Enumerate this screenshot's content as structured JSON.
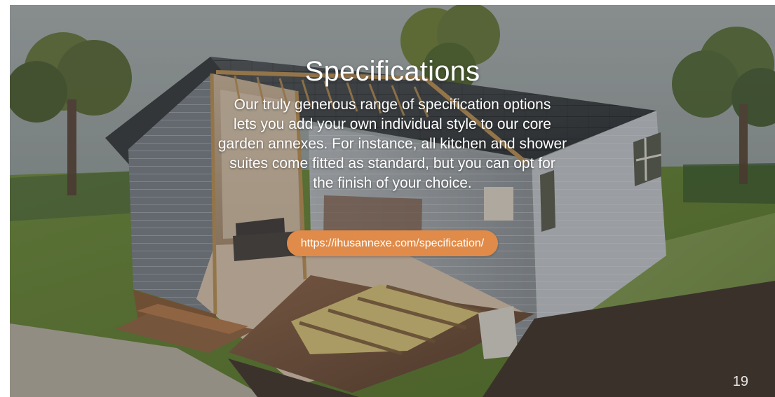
{
  "slide": {
    "title": "Specifications",
    "body_lines": [
      "Our truly generous range of specification options",
      "lets you add your own individual style to our core",
      "garden annexes. For instance, all kitchen and shower",
      "suites come fitted as standard, but you can opt for",
      "the finish of your choice."
    ],
    "link_text": "https://ihusannexe.com/specification/",
    "page_number": "19"
  },
  "colors": {
    "button": "#e08b49",
    "text": "#ffffff"
  },
  "icons": {
    "background": "garden-annexe-cutaway-image"
  }
}
